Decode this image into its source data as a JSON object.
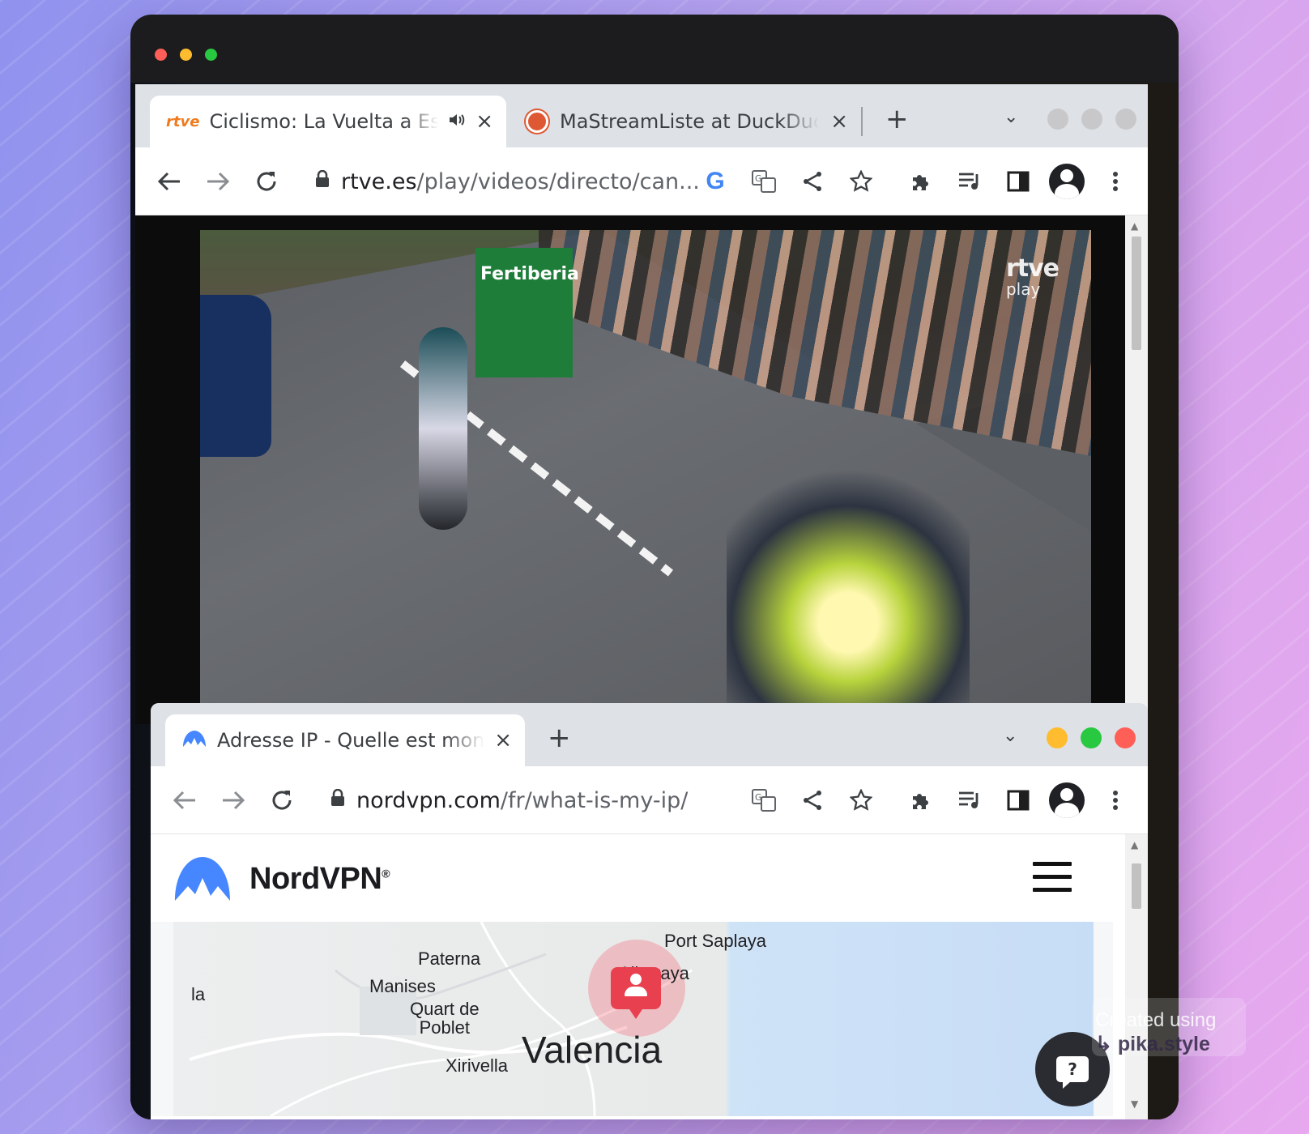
{
  "colors": {
    "light_red": "#ff5f57",
    "light_yellow": "#febc2e",
    "light_green": "#28c840",
    "nord_blue": "#4687ff",
    "pin_red": "#e9404f",
    "chrome_tabstrip": "#dee1e6"
  },
  "window_top": {
    "tabs": [
      {
        "favicon": "rtve-favicon",
        "favicon_text": "rtve",
        "title": "Ciclismo: La Vuelta a Espa",
        "audio": "speaker-icon",
        "active": true
      },
      {
        "favicon": "duckduckgo-favicon",
        "title": "MaStreamListe at DuckDuckG",
        "active": false
      }
    ],
    "new_tab": "+",
    "url_domain": "rtve.es",
    "url_path": "/play/videos/directo/can...",
    "video": {
      "overlay_brand_top": "rtve",
      "overlay_brand_bottom": "play",
      "banner_text": "Fertiberia"
    }
  },
  "window_bottom": {
    "tabs": [
      {
        "favicon": "nordvpn-favicon",
        "title": "Adresse IP - Quelle est mon IP",
        "active": true
      }
    ],
    "new_tab": "+",
    "url_domain": "nordvpn.com",
    "url_path": "/fr/what-is-my-ip/",
    "page": {
      "brand": "NordVPN",
      "brand_mark": "®",
      "map_labels": {
        "port_saplaya": "Port Saplaya",
        "paterna": "Paterna",
        "alboraya": "Alboraya",
        "manises": "Manises",
        "la": "la",
        "quart_line1": "Quart de",
        "quart_line2": "Poblet",
        "xirivella": "Xirivella",
        "valencia": "Valencia"
      },
      "help_glyph": "?"
    }
  },
  "watermark": {
    "line1": "Created using",
    "line2": "pika.style",
    "prefix": "↳"
  }
}
